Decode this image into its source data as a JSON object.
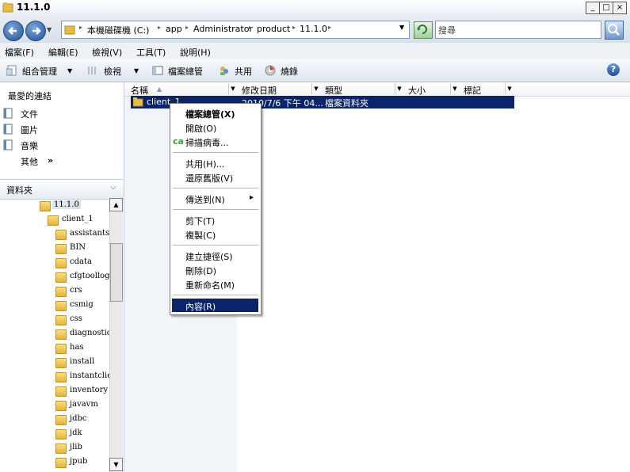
{
  "window": {
    "title": "11.1.0"
  },
  "address": {
    "crumbs": [
      "本機磁碟機 (C:)",
      "app",
      "Administrator",
      "product",
      "11.1.0"
    ]
  },
  "search": {
    "placeholder": "搜尋"
  },
  "menubar": [
    "檔案(F)",
    "編輯(E)",
    "檢視(V)",
    "工具(T)",
    "說明(H)"
  ],
  "toolbar": {
    "organize": "組合管理",
    "views": "檢視",
    "explorer": "檔案總管",
    "share": "共用",
    "burn": "燒錄"
  },
  "favorites": {
    "title": "最愛的連結",
    "items": [
      "文件",
      "圖片",
      "音樂",
      "其他"
    ],
    "more_chevron": "»"
  },
  "folders": {
    "title": "資料夾",
    "tree": [
      "11.1.0",
      "client_1",
      "assistants",
      "BIN",
      "cdata",
      "cfgtoollogs",
      "crs",
      "csmig",
      "css",
      "diagnostics",
      "has",
      "install",
      "instantclient",
      "inventory",
      "javavm",
      "jdbc",
      "jdk",
      "jlib",
      "jpub"
    ]
  },
  "columns": [
    "名稱",
    "修改日期",
    "類型",
    "大小",
    "標記"
  ],
  "rows": [
    {
      "name": "client_1",
      "date": "2010/7/6 下午 04...",
      "type": "檔案資料夾"
    }
  ],
  "context_menu": {
    "items": [
      "檔案總管(X)",
      "開啟(O)",
      "掃描病毒...",
      "共用(H)...",
      "還原舊版(V)",
      "傳送到(N)",
      "剪下(T)",
      "複製(C)",
      "建立捷徑(S)",
      "刪除(D)",
      "重新命名(M)",
      "內容(R)"
    ],
    "scan_prefix": "ca",
    "submenu_arrow": "▸"
  },
  "colors": {
    "selection": "#0a246a",
    "folder": "#e8bd45"
  }
}
